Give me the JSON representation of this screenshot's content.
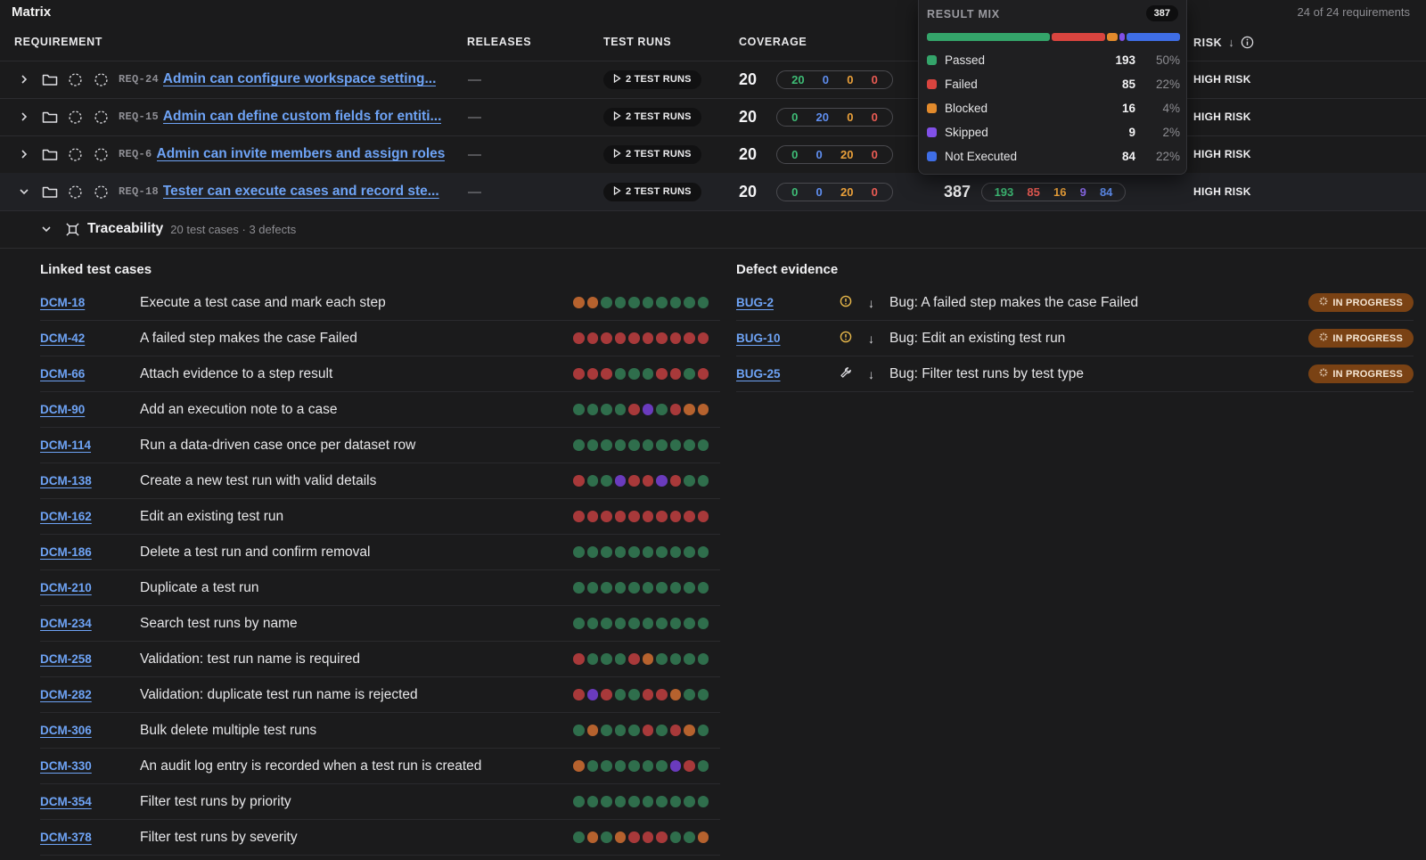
{
  "header": {
    "title": "Matrix",
    "requirements_count": "24 of 24 requirements",
    "columns": {
      "requirement": "REQUIREMENT",
      "releases": "RELEASES",
      "test_runs": "TEST RUNS",
      "coverage": "COVERAGE",
      "risk": "RISK"
    }
  },
  "requirements": [
    {
      "id": "REQ-24",
      "title": "Admin can configure workspace setting...",
      "releases": "—",
      "runs_label": "2 TEST RUNS",
      "coverage": "20",
      "breakdown": [
        "20",
        "0",
        "0",
        "0"
      ],
      "risk": "HIGH RISK",
      "expanded": false
    },
    {
      "id": "REQ-15",
      "title": "Admin can define custom fields for entiti...",
      "releases": "—",
      "runs_label": "2 TEST RUNS",
      "coverage": "20",
      "breakdown": [
        "0",
        "20",
        "0",
        "0"
      ],
      "risk": "HIGH RISK",
      "expanded": false
    },
    {
      "id": "REQ-6",
      "title": "Admin can invite members and assign roles",
      "releases": "—",
      "runs_label": "2 TEST RUNS",
      "coverage": "20",
      "breakdown": [
        "0",
        "0",
        "20",
        "0"
      ],
      "risk": "HIGH RISK",
      "expanded": false
    },
    {
      "id": "REQ-18",
      "title": "Tester can execute cases and record ste...",
      "releases": "—",
      "runs_label": "2 TEST RUNS",
      "coverage": "20",
      "breakdown": [
        "0",
        "0",
        "20",
        "0"
      ],
      "result_total": "387",
      "result_breakdown": [
        "193",
        "85",
        "16",
        "9",
        "84"
      ],
      "risk": "HIGH RISK",
      "expanded": true
    }
  ],
  "result_mix": {
    "title": "RESULT MIX",
    "total": "387",
    "items": [
      {
        "label": "Passed",
        "count": "193",
        "pct": "50%",
        "color": "#34a46a",
        "value": 193
      },
      {
        "label": "Failed",
        "count": "85",
        "pct": "22%",
        "color": "#d9443f",
        "value": 85
      },
      {
        "label": "Blocked",
        "count": "16",
        "pct": "4%",
        "color": "#e28a2c",
        "value": 16
      },
      {
        "label": "Skipped",
        "count": "9",
        "pct": "2%",
        "color": "#8150e8",
        "value": 9
      },
      {
        "label": "Not Executed",
        "count": "84",
        "pct": "22%",
        "color": "#3f6ee6",
        "value": 84
      }
    ]
  },
  "traceability": {
    "label": "Traceability",
    "meta": "20 test cases · 3 defects",
    "linked_heading": "Linked test cases",
    "defect_heading": "Defect evidence"
  },
  "test_cases": [
    {
      "id": "DCM-18",
      "name": "Execute a test case and mark each step",
      "dots": "ooggggggggg"
    },
    {
      "id": "DCM-42",
      "name": "A failed step makes the case Failed",
      "dots": "rrrrrrrrrr"
    },
    {
      "id": "DCM-66",
      "name": "Attach evidence to a step result",
      "dots": "rrrgggrrgr"
    },
    {
      "id": "DCM-90",
      "name": "Add an execution note to a case",
      "dots": "ggggrpgroo"
    },
    {
      "id": "DCM-114",
      "name": "Run a data-driven case once per dataset row",
      "dots": "gggggggggg"
    },
    {
      "id": "DCM-138",
      "name": "Create a new test run with valid details",
      "dots": "rggprrprgg"
    },
    {
      "id": "DCM-162",
      "name": "Edit an existing test run",
      "dots": "rrrrrrrrrr"
    },
    {
      "id": "DCM-186",
      "name": "Delete a test run and confirm removal",
      "dots": "gggggggggg"
    },
    {
      "id": "DCM-210",
      "name": "Duplicate a test run",
      "dots": "gggggggggg"
    },
    {
      "id": "DCM-234",
      "name": "Search test runs by name",
      "dots": "gggggggggg"
    },
    {
      "id": "DCM-258",
      "name": "Validation: test run name is required",
      "dots": "rgggrogggg"
    },
    {
      "id": "DCM-282",
      "name": "Validation: duplicate test run name is rejected",
      "dots": "rprggrrogg"
    },
    {
      "id": "DCM-306",
      "name": "Bulk delete multiple test runs",
      "dots": "gogggrgrog"
    },
    {
      "id": "DCM-330",
      "name": "An audit log entry is recorded when a test run is created",
      "dots": "oggggggprgr"
    },
    {
      "id": "DCM-354",
      "name": "Filter test runs by priority",
      "dots": "gggggggggg"
    },
    {
      "id": "DCM-378",
      "name": "Filter test runs by severity",
      "dots": "gogorrrggo"
    }
  ],
  "defects": [
    {
      "id": "BUG-2",
      "title": "Bug: A failed step makes the case Failed",
      "severity_icon": "alert-circle-icon",
      "status": "IN PROGRESS"
    },
    {
      "id": "BUG-10",
      "title": "Bug: Edit an existing test run",
      "severity_icon": "alert-circle-icon",
      "status": "IN PROGRESS"
    },
    {
      "id": "BUG-25",
      "title": "Bug: Filter test runs by test type",
      "severity_icon": "wrench-icon",
      "status": "IN PROGRESS"
    }
  ]
}
